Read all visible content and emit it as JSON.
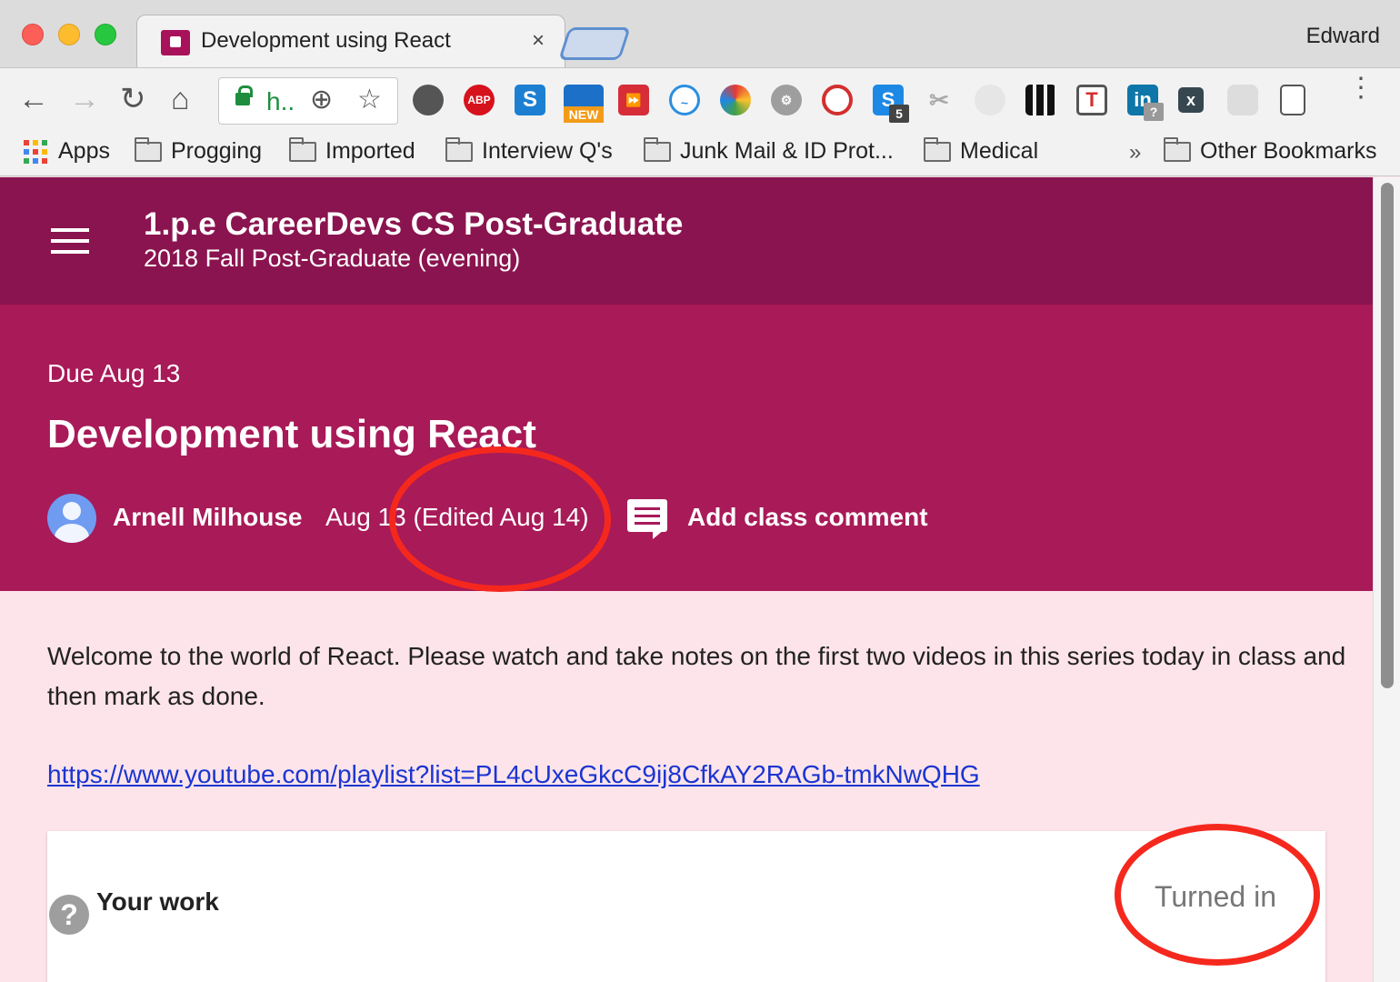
{
  "browser": {
    "tab_title": "Development using React",
    "tab_close": "×",
    "profile_name": "Edward",
    "url_display": "h..",
    "extensions": [
      "evernote-icon",
      "adblock-plus-icon",
      "s-extension-icon",
      "new-extension-icon",
      "forward-extension-icon",
      "sync-extension-icon",
      "color-extension-icon",
      "settings-extension-icon",
      "block-extension-icon",
      "skype-extension-icon",
      "scissors-extension-icon",
      "circle-extension-icon",
      "grid-extension-icon",
      "t-extension-icon",
      "linkedin-extension-icon",
      "x-extension-icon",
      "hexagon-extension-icon",
      "notes-extension-icon"
    ],
    "ext_badges": {
      "abp": "ABP",
      "new": "NEW",
      "skype_count": "5",
      "linkedin_badge": "?"
    }
  },
  "bookmarks": {
    "apps": "Apps",
    "items": [
      "Progging",
      "Imported",
      "Interview Q's",
      "Junk Mail & ID Prot...",
      "Medical"
    ],
    "overflow": "»",
    "other": "Other Bookmarks"
  },
  "course": {
    "title": "1.p.e CareerDevs CS Post-Graduate",
    "subtitle": "2018 Fall Post-Graduate (evening)"
  },
  "assignment": {
    "due": "Due Aug 13",
    "title": "Development using React",
    "author": "Arnell Milhouse",
    "posted": "Aug 13 (Edited Aug 14)",
    "add_comment": "Add class comment",
    "description": "Welcome to the world of React. Please watch and take notes on the first two videos in this series today in class and then mark as done.",
    "link": "https://www.youtube.com/playlist?list=PL4cUxeGkcC9ij8CfkAY2RAGb-tmkNwQHG"
  },
  "work": {
    "label": "Your work",
    "status": "Turned in",
    "help_glyph": "?"
  },
  "colors": {
    "header": "#8a144f",
    "banner": "#a81a58",
    "page_bg": "#fde4ea",
    "annotation": "#f5281e",
    "link": "#1a35d1"
  }
}
